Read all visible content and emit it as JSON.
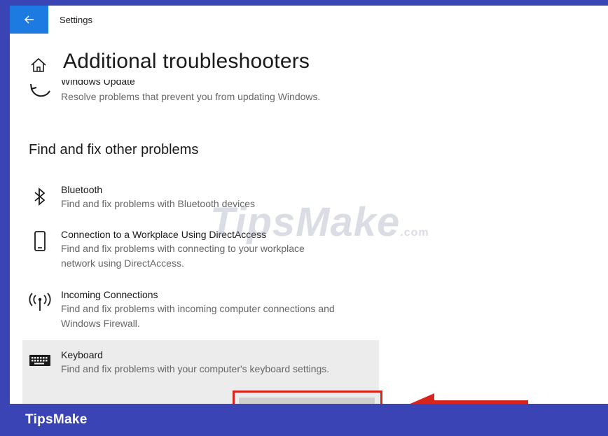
{
  "window": {
    "title": "Settings",
    "back_icon": "arrow-left-icon"
  },
  "page": {
    "title": "Additional troubleshooters",
    "home_icon": "home-icon"
  },
  "windows_update": {
    "name": "Windows Update",
    "description": "Resolve problems that prevent you from updating Windows.",
    "icon": "refresh-icon"
  },
  "section": {
    "heading": "Find and fix other problems"
  },
  "items": [
    {
      "name": "Bluetooth",
      "description": "Find and fix problems with Bluetooth devices",
      "icon": "bluetooth-icon"
    },
    {
      "name": "Connection to a Workplace Using DirectAccess",
      "description_line1": "Find and fix problems with connecting to your workplace",
      "description_line2": "network using DirectAccess.",
      "icon": "phone-icon"
    },
    {
      "name": "Incoming Connections",
      "description_line1": "Find and fix problems with incoming computer connections and",
      "description_line2": "Windows Firewall.",
      "icon": "antenna-icon"
    },
    {
      "name": "Keyboard",
      "description": "Find and fix problems with your computer's keyboard settings.",
      "icon": "keyboard-icon"
    }
  ],
  "watermark": {
    "text": "TipsMake",
    "suffix": ".com"
  },
  "footer": {
    "brand": "TipsMake"
  },
  "colors": {
    "accent": "#1c7ae0",
    "frame": "#3a44b4",
    "highlight_border": "#d9241d",
    "selected_bg": "#ececec"
  }
}
